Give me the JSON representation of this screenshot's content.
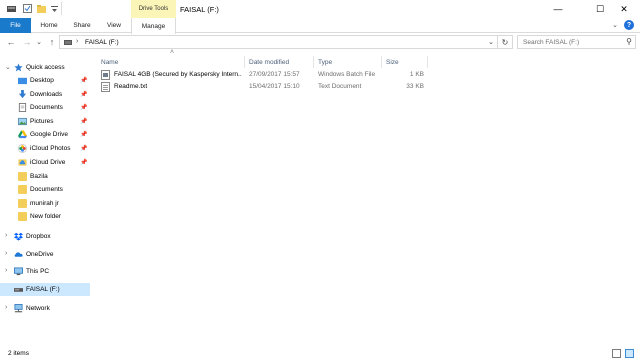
{
  "window": {
    "title": "FAISAL (F:)",
    "context_tab_group": "Drive Tools",
    "controls": {
      "minimize": "—",
      "maximize": "☐",
      "close": "✕"
    }
  },
  "ribbon": {
    "tabs": [
      "File",
      "Home",
      "Share",
      "View",
      "Manage"
    ],
    "expand_glyph": "⌄",
    "help": "?"
  },
  "address_bar": {
    "path": "FAISAL (F:)",
    "separator": "›",
    "dropdown_glyph": "⌄",
    "refresh_glyph": "↻"
  },
  "search": {
    "placeholder": "Search FAISAL (F:)",
    "icon_glyph": "⚲"
  },
  "nav_buttons": {
    "back": "←",
    "forward": "→",
    "recent": "⌄",
    "up": "↑"
  },
  "nav_pane": {
    "quick_access": "Quick access",
    "pinned": [
      "Desktop",
      "Downloads",
      "Documents",
      "Pictures",
      "Google Drive",
      "iCloud Photos",
      "iCloud Drive"
    ],
    "folders": [
      "Bazila",
      "Documents",
      "munirah jr",
      "New folder"
    ],
    "roots": [
      "Dropbox",
      "OneDrive",
      "This PC",
      "FAISAL (F:)",
      "Network"
    ],
    "pin_glyph": "📌",
    "chevron_glyph": "›",
    "expanded_glyph": "⌄"
  },
  "file_list": {
    "columns": [
      "Name",
      "Date modified",
      "Type",
      "Size"
    ],
    "sort_glyph": "˄",
    "rows": [
      {
        "name": "FAISAL 4GB (Secured by Kaspersky Intern...",
        "date": "27/09/2017 15:57",
        "type": "Windows Batch File",
        "size": "1 KB",
        "icon": "batch-file-icon"
      },
      {
        "name": "Readme.txt",
        "date": "15/04/2017 15:10",
        "type": "Text Document",
        "size": "33 KB",
        "icon": "text-file-icon"
      }
    ]
  },
  "status": {
    "items": "2 items"
  },
  "colors": {
    "file_tab": "#1979ca",
    "context_tab": "#fbf5b7",
    "selection": "#cce8ff",
    "folder": "#f3ce5a"
  }
}
